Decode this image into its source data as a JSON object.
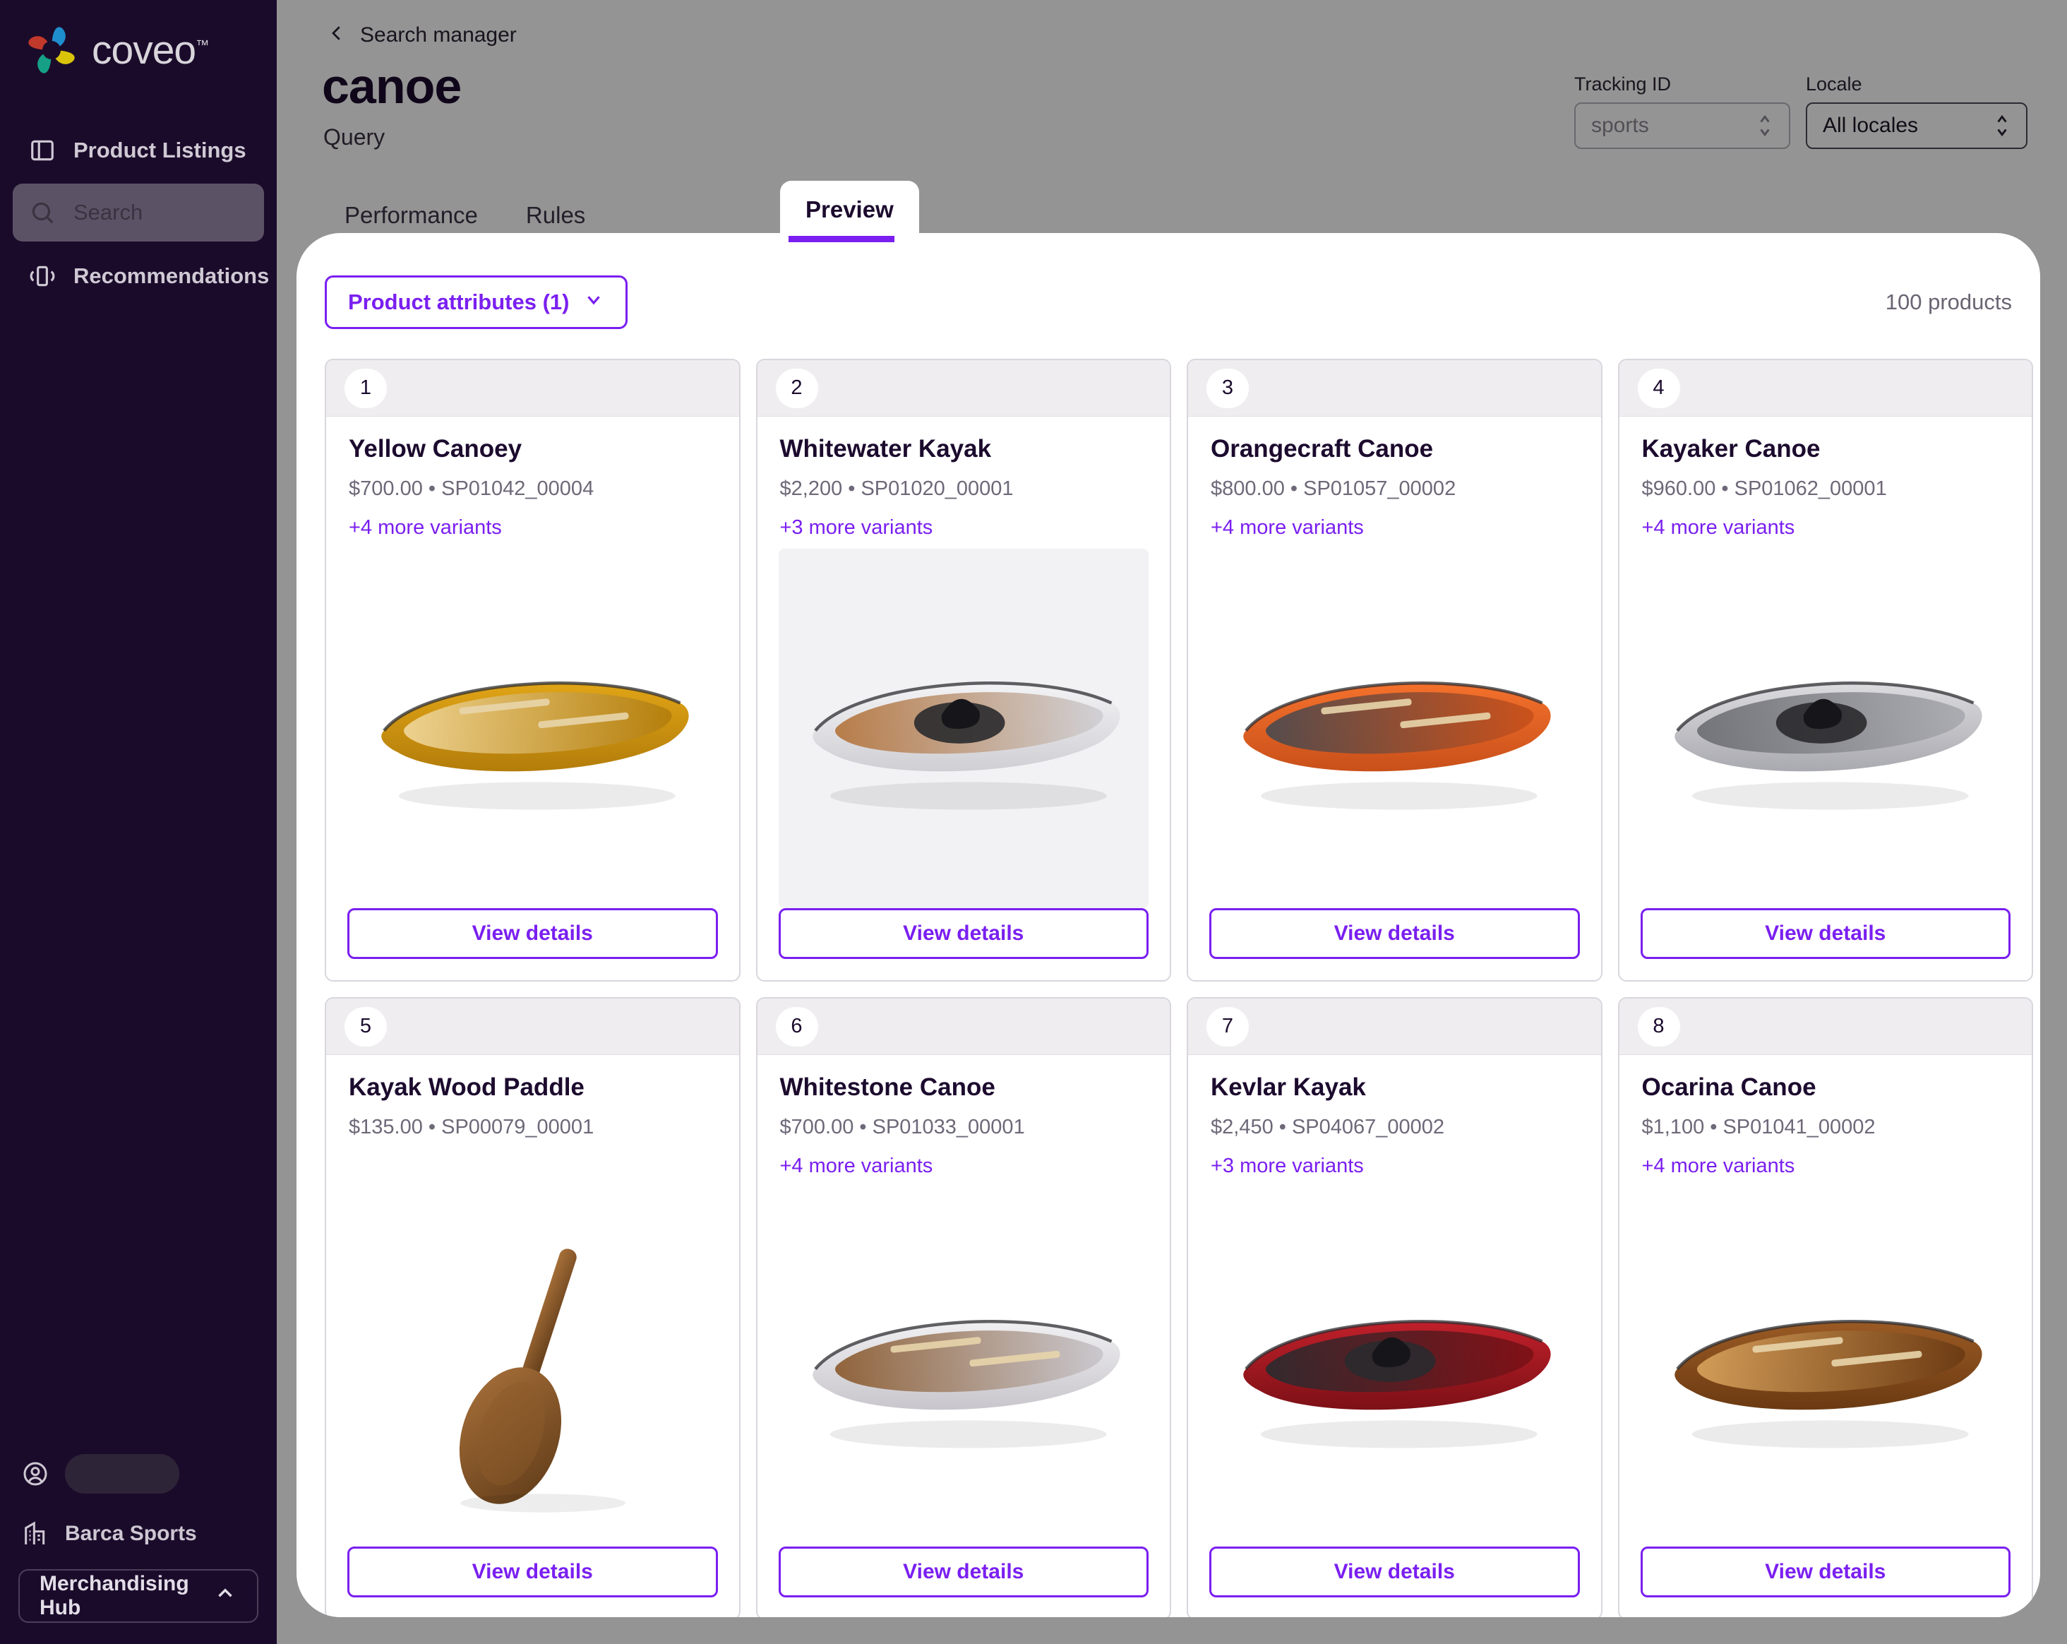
{
  "sidebar": {
    "brand": {
      "name": "coveo",
      "tm": "™",
      "logo_icon": "coveo-logo-icon"
    },
    "items": [
      {
        "label": "Product Listings",
        "icon": "panel-left-icon",
        "active": false
      },
      {
        "label": "Search",
        "icon": "search-icon",
        "active": true
      },
      {
        "label": "Recommendations",
        "icon": "carousel-icon",
        "active": false
      }
    ],
    "footer": {
      "user_icon": "user-circle-icon",
      "user_name": "",
      "org_icon": "building-icon",
      "org_name": "Barca Sports",
      "hub_label": "Merchandising Hub",
      "hub_chevron": "chevron-up-icon"
    }
  },
  "header": {
    "back_icon": "chevron-left-icon",
    "breadcrumb": "Search manager",
    "title": "canoe",
    "subtitle": "Query",
    "tracking": {
      "label": "Tracking ID",
      "value": "sports",
      "stepper_icon": "stepper-updown-icon"
    },
    "locale": {
      "label": "Locale",
      "value": "All locales",
      "stepper_icon": "stepper-updown-icon"
    },
    "tabs": [
      {
        "label": "Performance",
        "active": false
      },
      {
        "label": "Rules",
        "active": false
      },
      {
        "label": "Preview",
        "active": true
      }
    ]
  },
  "toolbar": {
    "attributes_label": "Product attributes (1)",
    "attributes_chevron": "chevron-down-icon",
    "product_count": "100 products"
  },
  "accent": {
    "purple": "#7a1ff0",
    "dark": "#1c0b2e",
    "muted": "#6e6878"
  },
  "products": [
    {
      "rank": "1",
      "title": "Yellow Canoey",
      "meta": "$700.00 • SP01042_00004",
      "variants": "+4 more variants",
      "cta": "View details",
      "image_icon": "yellow-canoe-image",
      "tinted": false,
      "color_a": "#e0a416",
      "color_b": "#b37d0a",
      "inner": "#f0d79a"
    },
    {
      "rank": "2",
      "title": "Whitewater Kayak",
      "meta": "$2,200 • SP01020_00001",
      "variants": "+3 more variants",
      "cta": "View details",
      "image_icon": "whitewater-kayak-image",
      "tinted": true,
      "color_a": "#f3f3f5",
      "color_b": "#cfcfd4",
      "inner": "#b4743c"
    },
    {
      "rank": "3",
      "title": "Orangecraft Canoe",
      "meta": "$800.00 • SP01057_00002",
      "variants": "+4 more variants",
      "cta": "View details",
      "image_icon": "orangecraft-canoe-image",
      "tinted": false,
      "color_a": "#f4712c",
      "color_b": "#c9501a",
      "inner": "#4a4a4f"
    },
    {
      "rank": "4",
      "title": "Kayaker Canoe",
      "meta": "$960.00 • SP01062_00001",
      "variants": "+4 more variants",
      "cta": "View details",
      "image_icon": "kayaker-canoe-image",
      "tinted": false,
      "color_a": "#dcdcdf",
      "color_b": "#a9a9b0",
      "inner": "#6d6d74"
    },
    {
      "rank": "5",
      "title": "Kayak Wood Paddle",
      "meta": "$135.00 • SP00079_00001",
      "variants": "",
      "cta": "View details",
      "image_icon": "wood-paddle-image",
      "tinted": false,
      "color_a": "#8b5a2b",
      "color_b": "#5e3a18",
      "inner": "#a9713a"
    },
    {
      "rank": "6",
      "title": "Whitestone Canoe",
      "meta": "$700.00 • SP01033_00001",
      "variants": "+4 more variants",
      "cta": "View details",
      "image_icon": "whitestone-canoe-image",
      "tinted": false,
      "color_a": "#f0efF1",
      "color_b": "#c8c6cc",
      "inner": "#8a5a2e"
    },
    {
      "rank": "7",
      "title": "Kevlar Kayak",
      "meta": "$2,450 • SP04067_00002",
      "variants": "+3 more variants",
      "cta": "View details",
      "image_icon": "kevlar-kayak-image",
      "tinted": false,
      "color_a": "#c0202a",
      "color_b": "#7d1016",
      "inner": "#2b2b2f"
    },
    {
      "rank": "8",
      "title": "Ocarina Canoe",
      "meta": "$1,100 • SP01041_00002",
      "variants": "+4 more variants",
      "cta": "View details",
      "image_icon": "ocarina-canoe-image",
      "tinted": false,
      "color_a": "#9a5a24",
      "color_b": "#6b3a12",
      "inner": "#d8a25c"
    }
  ]
}
